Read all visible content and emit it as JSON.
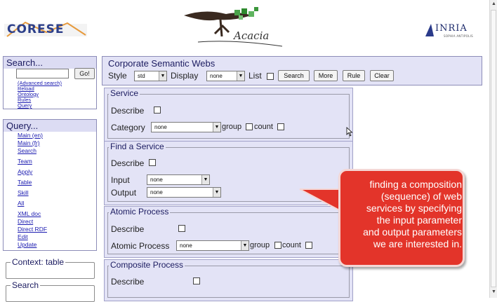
{
  "header": {
    "corese_logo": "CORESE",
    "acacia_logo": "Acacia",
    "inria_logo": "INRIA",
    "inria_subtitle": "SOPHIA ANTIPOLIS"
  },
  "search_panel": {
    "title": "Search...",
    "go_label": "Go!",
    "links": [
      "(Advanced search)",
      "Reload",
      "Ontology",
      "Rules",
      "Query"
    ]
  },
  "query_panel": {
    "title": "Query...",
    "links": [
      "Main (en)",
      "Main (fr)",
      "Search",
      "Team",
      "Apply",
      "Table",
      "Skill",
      "All",
      "XML doc",
      "Direct",
      "Direct RDF",
      "Edit",
      "Update"
    ]
  },
  "context_box": {
    "legend": "Context: table"
  },
  "search_box": {
    "legend": "Search"
  },
  "toolbar": {
    "title": "Corporate Semantic Webs",
    "style_label": "Style",
    "style_value": "std",
    "display_label": "Display",
    "display_value": "none",
    "list_label": "List",
    "search_button": "Search",
    "more_button": "More",
    "rule_button": "Rule",
    "clear_button": "Clear"
  },
  "sections": {
    "service": {
      "title": "Service",
      "describe_label": "Describe",
      "category_label": "Category",
      "category_value": "none",
      "group_label": "group",
      "count_label": "count"
    },
    "find_service": {
      "title": "Find a Service",
      "describe_label": "Describe",
      "input_label": "Input",
      "input_value": "none",
      "output_label": "Output",
      "output_value": "none"
    },
    "atomic_process": {
      "title": "Atomic Process",
      "describe_label": "Describe",
      "process_label": "Atomic Process",
      "process_value": "none",
      "group_label": "group",
      "count_label": "count"
    },
    "composite_process": {
      "title": "Composite Process",
      "describe_label": "Describe"
    }
  },
  "callout": {
    "text": "finding a composition\n(sequence) of web\nservices by specifying\nthe input parameter\nand output parameters\nwe are interested in."
  },
  "colors": {
    "panel_bg": "#e3e3f6",
    "title_text": "#1b1b60",
    "link": "#1a1ab0",
    "callout_bg": "#e3342a"
  }
}
